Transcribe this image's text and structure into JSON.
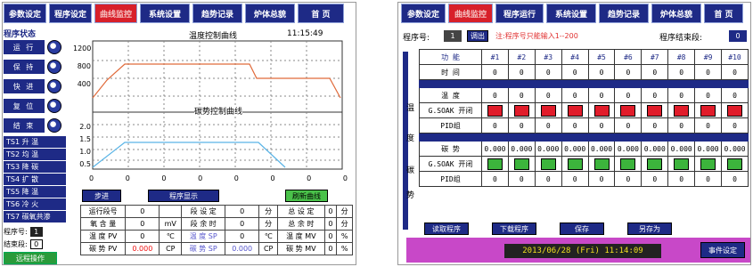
{
  "left_nav": [
    "参数设定",
    "程序设定",
    "曲线监控",
    "系统设置",
    "趋势记录",
    "炉体总貌",
    "首 页"
  ],
  "right_nav": [
    "参数设定",
    "曲线监控",
    "程序运行",
    "系统设置",
    "趋势记录",
    "炉体总貌",
    "首 页"
  ],
  "side": {
    "title": "程序状态",
    "controls": [
      "运 行",
      "保 持",
      "快 进",
      "复 位",
      "结 束"
    ],
    "ts": [
      "TS1 升    温",
      "TS2 均    温",
      "TS3 降    碳",
      "TS4 扩    散",
      "TS5 降    温",
      "TS6 冷    火",
      "TS7 碳氧共渗"
    ],
    "prog_no_label": "程序号:",
    "prog_no": "1",
    "end_seg_label": "结束段:",
    "end_seg": "0",
    "remote": "远程操作"
  },
  "temp_chart": {
    "title": "温度控制曲线",
    "time": "11:15:49",
    "yticks": [
      "1200",
      "800",
      "400"
    ],
    "xticks": [
      "0",
      "0",
      "0",
      "0",
      "0",
      "0",
      "0",
      "0"
    ]
  },
  "carbon_chart": {
    "title": "碳势控制曲线",
    "yticks": [
      "2.0",
      "1.5",
      "1.0",
      "0.5"
    ],
    "xticks": [
      "0",
      "0",
      "0",
      "0",
      "0",
      "0",
      "0",
      "0"
    ]
  },
  "buttons": {
    "step": "步进",
    "display": "程序显示",
    "refresh": "刷新曲线"
  },
  "table": [
    [
      "运行段号",
      "0",
      "",
      "段 设 定",
      "0",
      "分",
      "总 设 定",
      "0",
      "分"
    ],
    [
      "氧 含 量",
      "0",
      "mV",
      "段 余 时",
      "0",
      "分",
      "总 余 时",
      "0",
      "分"
    ],
    [
      "温 度 PV",
      "0",
      "℃",
      "温 度 SP",
      "0",
      "℃",
      "温 度 MV",
      "0",
      "%"
    ],
    [
      "碳 势 PV",
      "0.000",
      "CP",
      "碳 势 SP",
      "0.000",
      "CP",
      "碳 势 MV",
      "0",
      "%"
    ]
  ],
  "right": {
    "prog_label": "程序号:",
    "prog_val": "1",
    "call": "调出",
    "note": "注:程序号只能输入1--200",
    "end_label": "程序结束段:",
    "end_val": "0",
    "headers": [
      "功 能",
      "时 间",
      "#1",
      "#2",
      "#3",
      "#4",
      "#5",
      "#6",
      "#7",
      "#8",
      "#9",
      "#10"
    ],
    "time_row": [
      "0",
      "0",
      "0",
      "0",
      "0",
      "0",
      "0",
      "0",
      "0",
      "0"
    ],
    "temp_label": "温 度",
    "temp_vals": [
      "0",
      "0",
      "0",
      "0",
      "0",
      "0",
      "0",
      "0",
      "0",
      "0"
    ],
    "soak_label": "G.SOAK 开闭",
    "pid_label": "PID组",
    "pid_vals": [
      "0",
      "0",
      "0",
      "0",
      "0",
      "0",
      "0",
      "0",
      "0",
      "0"
    ],
    "carbon_label": "碳 势",
    "carbon_vals": [
      "0.000",
      "0.000",
      "0.000",
      "0.000",
      "0.000",
      "0.000",
      "0.000",
      "0.000",
      "0.000",
      "0.000"
    ],
    "side_wen": "温",
    "side_du": "度",
    "side_tan": "碳",
    "side_shi": "势",
    "buttons": [
      "读取程序",
      "下载程序",
      "保存",
      "另存为"
    ],
    "datetime": "2013/06/28 (Fri) 11:14:09",
    "event": "事件设定"
  },
  "colors": {
    "nav": "#1e2a86",
    "active": "#d8202a",
    "curve": "#e06a3a",
    "carbon": "#5ab4e6"
  }
}
